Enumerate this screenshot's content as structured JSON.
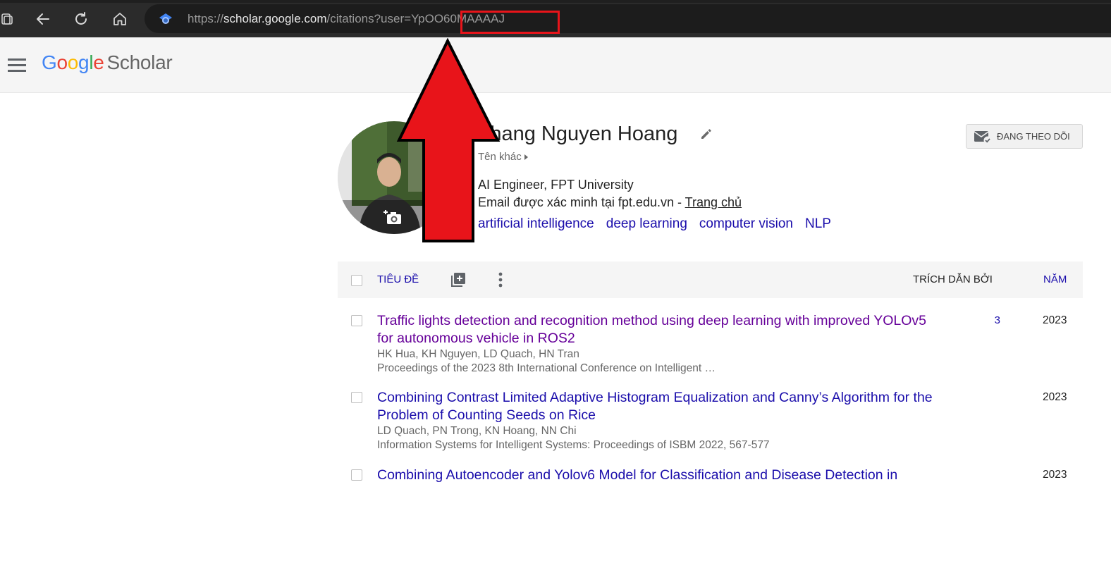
{
  "browser": {
    "url_prefix": "https://",
    "url_host": "scholar.google.com",
    "url_path": "/citations?user=",
    "url_user_id": "YpOO60MAAAAJ"
  },
  "header": {
    "logo_g1": "G",
    "logo_o1": "o",
    "logo_o2": "o",
    "logo_g2": "g",
    "logo_l": "l",
    "logo_e": "e",
    "logo_scholar": "Scholar"
  },
  "profile": {
    "name": "Khang Nguyen Hoang",
    "alt_names": "Tên khác",
    "affiliation": "AI Engineer, FPT University",
    "email_text": "Email được xác minh tại fpt.edu.vn - ",
    "homepage": "Trang chủ",
    "interests": [
      "artificial intelligence",
      "deep learning",
      "computer vision",
      "NLP"
    ],
    "follow_label": "ĐANG THEO DÕI"
  },
  "table": {
    "col_title": "TIÊU ĐỀ",
    "col_cited_by": "TRÍCH DẪN BỞI",
    "col_year": "NĂM"
  },
  "articles": [
    {
      "title": "Traffic lights detection and recognition method using deep learning with improved YOLOv5 for autonomous vehicle in ROS2",
      "authors": "HK Hua, KH Nguyen, LD Quach, HN Tran",
      "venue": "Proceedings of the 2023 8th International Conference on Intelligent …",
      "cited_by": "3",
      "year": "2023"
    },
    {
      "title": "Combining Contrast Limited Adaptive Histogram Equalization and Canny’s Algorithm for the Problem of Counting Seeds on Rice",
      "authors": "LD Quach, PN Trong, KN Hoang, NN Chi",
      "venue": "Information Systems for Intelligent Systems: Proceedings of ISBM 2022, 567-577",
      "cited_by": "",
      "year": "2023"
    },
    {
      "title": "Combining Autoencoder and Yolov6 Model for Classification and Disease Detection in",
      "year": "2023"
    }
  ],
  "colors": {
    "highlight_red": "#e8141a",
    "link_blue": "#1a0dab",
    "visited_purple": "#660099"
  }
}
